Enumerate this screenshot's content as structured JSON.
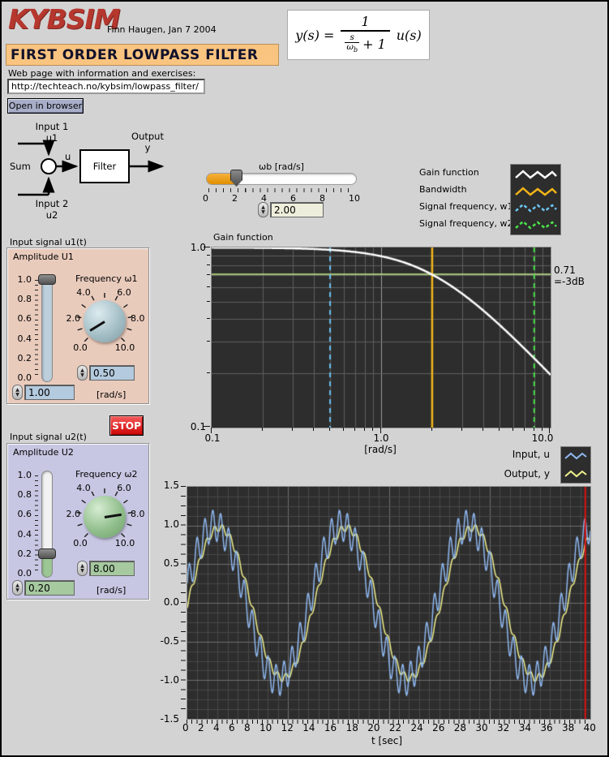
{
  "header": {
    "logo": "KYBSIM",
    "byline": "Finn Haugen, Jan 7 2004",
    "title": "FIRST ORDER LOWPASS FILTER",
    "web_label": "Web page with information and exercises:",
    "url": "http://techteach.no/kybsim/lowpass_filter/",
    "open_button": "Open in browser"
  },
  "formula": {
    "lhs": "y(s)",
    "eq": "=",
    "num": "1",
    "den_s": "s",
    "den_omega": "ω",
    "den_omega_sub": "b",
    "den_plus": "+ 1",
    "rhs": "u(s)"
  },
  "diagram": {
    "input1_line1": "Input 1",
    "input1_line2": "u1",
    "input2_line1": "Input 2",
    "input2_line2": "u2",
    "sum_label": "Sum",
    "u_label": "u",
    "filter_label": "Filter",
    "output_line1": "Output",
    "output_line2": "y"
  },
  "wb_slider": {
    "label": "ωb [rad/s]",
    "scale": [
      "0",
      "2",
      "4",
      "6",
      "8",
      "10"
    ],
    "min": 0,
    "max": 10,
    "current": 2,
    "value": "2.00"
  },
  "gain_legend": {
    "items": [
      {
        "label": "Gain function",
        "color": "#ffffff",
        "dashed": false
      },
      {
        "label": "Bandwidth",
        "color": "#f2b419",
        "dashed": false
      },
      {
        "label": "Signal frequency, w1",
        "color": "#6cc4f2",
        "dashed": true
      },
      {
        "label": "Signal frequency, w2",
        "color": "#4ae24a",
        "dashed": true
      }
    ]
  },
  "time_legend": {
    "input_label": "Input, u",
    "input_color": "#8fb8f0",
    "output_label": "Output, y",
    "output_color": "#f0f08c"
  },
  "stop_button": "STOP",
  "u1": {
    "caption": "Input signal u1(t)",
    "amp_label": "Amplitude U1",
    "freq_label": "Frequency ω1",
    "slider_scale": [
      "1.0",
      "0.8",
      "0.6",
      "0.4",
      "0.2",
      "0.0"
    ],
    "knob_scale": [
      "4.0",
      "6.0",
      "2.0",
      "8.0",
      "0.0",
      "10.0"
    ],
    "amp_value": "1.00",
    "amp_current": 1.0,
    "freq_value": "0.50",
    "freq_current": 0.5,
    "unit": "[rad/s]"
  },
  "u2": {
    "caption": "Input signal u2(t)",
    "amp_label": "Amplitude U2",
    "freq_label": "Frequency ω2",
    "slider_scale": [
      "1.0",
      "0.8",
      "0.6",
      "0.4",
      "0.2",
      "0.0"
    ],
    "knob_scale": [
      "4.0",
      "6.0",
      "2.0",
      "8.0",
      "0.0",
      "10.0"
    ],
    "amp_value": "0.20",
    "amp_current": 0.2,
    "freq_value": "8.00",
    "freq_current": 8.0,
    "unit": "[rad/s]"
  },
  "colors": {
    "page_bg": "#d3d3d3",
    "plot_bg": "#2d2d2d",
    "grid_minor": "#5f5f5f",
    "grid_major": "#9c9c9c",
    "time_grid_minor": "#484848",
    "time_grid_major": "#6f6f6f"
  },
  "chart_data": [
    {
      "type": "line",
      "title": "Gain function",
      "xlabel": "[rad/s]",
      "xscale": "log",
      "yscale": "log",
      "xlim": [
        0.1,
        10
      ],
      "ylim": [
        0.1,
        1.0
      ],
      "xticks": [
        "0.1",
        "1.0",
        "10.0"
      ],
      "yticks": [
        "1.0",
        "0.1"
      ],
      "curve": {
        "name": "Gain function",
        "color": "#ffffff",
        "formula": "gain(w) = 1/sqrt(1+(w/wb)^2)",
        "wb": 2
      },
      "markers": [
        {
          "name": "Signal frequency, w1",
          "w": 0.5,
          "color": "#6cc4f2",
          "style": "dashed"
        },
        {
          "name": "Bandwidth",
          "w": 2.0,
          "color": "#f2b419",
          "style": "solid"
        },
        {
          "name": "Signal frequency, w2",
          "w": 8.0,
          "color": "#4ae24a",
          "style": "dashed"
        }
      ],
      "hline": {
        "y": 0.71,
        "color": "#c6ee8a",
        "label_line1": "0.71",
        "label_line2": "=-3dB"
      }
    },
    {
      "type": "line",
      "xlabel": "t [sec]",
      "xlim": [
        0,
        40
      ],
      "ylim": [
        -1.5,
        1.5
      ],
      "xticks": [
        "0",
        "2",
        "4",
        "6",
        "8",
        "10",
        "12",
        "14",
        "16",
        "18",
        "20",
        "22",
        "24",
        "26",
        "28",
        "30",
        "32",
        "34",
        "36",
        "38",
        "40"
      ],
      "yticks": [
        "1.5",
        "1.0",
        "0.5",
        "0.0",
        "-0.5",
        "-1.0",
        "-1.5"
      ],
      "filter_bandwidth": 2,
      "series": [
        {
          "name": "Input, u",
          "color": "#8fb8f0",
          "components": [
            {
              "amplitude": 1.0,
              "frequency": 0.5,
              "phase": 0.22
            },
            {
              "amplitude": 0.2,
              "frequency": 8.0,
              "phase": 0.2
            }
          ]
        },
        {
          "name": "Output, y",
          "color": "#f0f08c",
          "derived": "first_order_lowpass_of_input",
          "wb": 2
        }
      ],
      "cursor": {
        "t": 39.5,
        "color": "#dd1111"
      }
    }
  ]
}
